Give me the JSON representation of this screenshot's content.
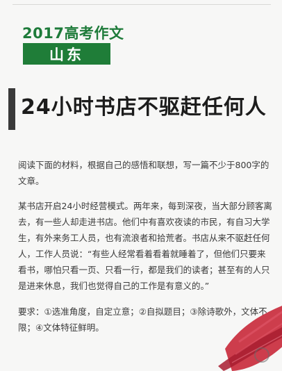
{
  "header": {
    "year_title": "2017高考作文",
    "province": "山东"
  },
  "title": "24小时书店不驱赶任何人",
  "paragraphs": {
    "instruction": "阅读下面的材料，根据自己的感悟和联想，写一篇不少于800字的文章。",
    "material": "某书店开启24小时经营模式。两年来，每到深夜，当大部分顾客离去，有一些人却走进书店。他们中有喜欢夜读的市民，有自习大学生，有外来务工人员，也有流浪者和拾荒者。书店从来不驱赶任何人，工作人员说：“有些人经常看着看着就睡着了，但他们只要来看书，哪怕只看一页、只看一行，都是我们的读者；甚至有的人只是进来休息，我们也觉得自己的工作是有意义的。”",
    "requirements": "要求：①选准角度，自定立意；②自拟题目；③除诗歌外，文体不限；④文体特征鲜明。"
  },
  "colors": {
    "brand_green": "#1f7d38",
    "brush_red": "#c8283a"
  }
}
